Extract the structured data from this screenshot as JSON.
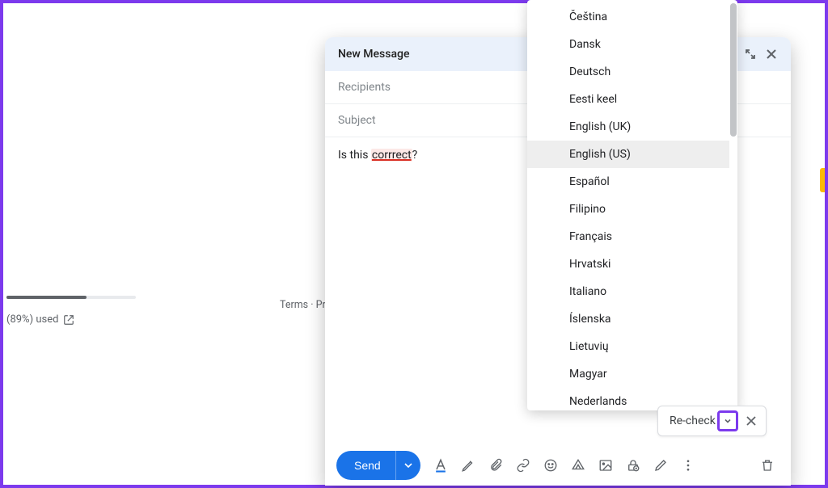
{
  "storage": {
    "percent_label": "(89%) used"
  },
  "footer": {
    "terms": "Terms",
    "dot": "·",
    "privacy_truncated": "Priva"
  },
  "compose": {
    "title": "New Message",
    "recipients_placeholder": "Recipients",
    "subject_placeholder": "Subject",
    "body_prefix": "Is this ",
    "body_misspelled": "corrrect",
    "body_suffix": "?",
    "send_label": "Send"
  },
  "lang_menu": {
    "items": [
      "Čeština",
      "Dansk",
      "Deutsch",
      "Eesti keel",
      "English (UK)",
      "English (US)",
      "Español",
      "Filipino",
      "Français",
      "Hrvatski",
      "Italiano",
      "Íslenska",
      "Lietuvių",
      "Magyar",
      "Nederlands"
    ],
    "selected_index": 5
  },
  "recheck": {
    "label": "Re-check"
  }
}
